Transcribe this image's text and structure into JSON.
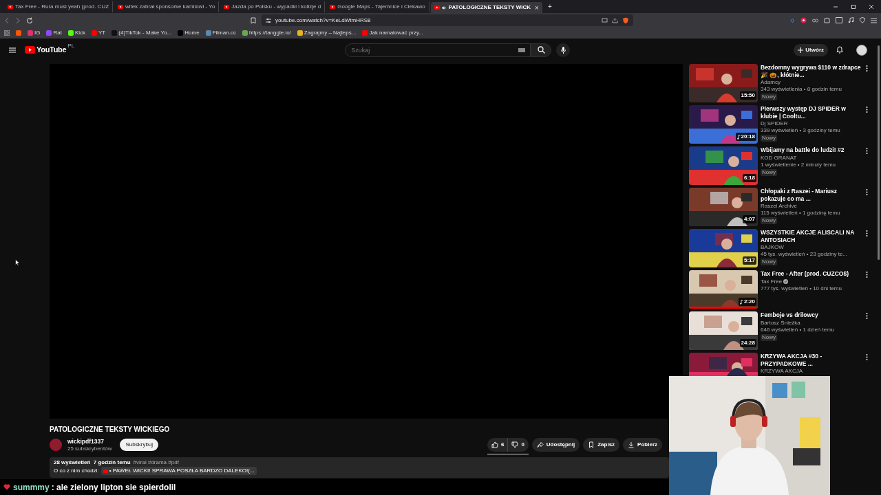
{
  "browser": {
    "tabs": [
      {
        "title": "Tax Free - Rura musi yeah (prod. CUZ",
        "selected": false,
        "audio": false
      },
      {
        "title": "witek zabrał sponsorke kamilowi - Yo",
        "selected": false,
        "audio": false
      },
      {
        "title": "Jazda po Polsku - wypadki i kolizje d",
        "selected": false,
        "audio": false
      },
      {
        "title": "Google Maps - Tajemnice i Ciekawo",
        "selected": false,
        "audio": false
      },
      {
        "title": "PATOLOGICZNE TEKSTY WICK",
        "selected": true,
        "audio": true
      }
    ],
    "close_glyph": "×",
    "new_tab_glyph": "+",
    "url": "youtube.com/watch?v=KeLdWtmHRS8",
    "bookmarks": [
      {
        "color": "#ff5500"
      },
      {
        "label": "IG",
        "color": "#e1306c"
      },
      {
        "label": "Rat",
        "color": "#9146ff"
      },
      {
        "label": "Kick",
        "color": "#53fc18"
      },
      {
        "label": "YT",
        "color": "#ff0000"
      },
      {
        "label": "(4)TikTok - Make Yo...",
        "color": "#111111"
      },
      {
        "label": "Home",
        "color": "#000000"
      },
      {
        "label": "Filman.cc",
        "color": "#5a8ab0"
      },
      {
        "label": "https://tanggle.io/",
        "color": "#6aa84f"
      },
      {
        "label": "Zagrajmy – Najleps...",
        "color": "#e6b422"
      },
      {
        "label": "Jak namalować przy...",
        "color": "#ff0000"
      }
    ]
  },
  "header": {
    "logo": "YouTube",
    "region": "PL",
    "search": {
      "placeholder": "Szukaj"
    },
    "create": "Utwórz"
  },
  "video": {
    "title": "PATOLOGICZNE TEKSTY WICKIEGO",
    "channel": "wickipdf1337",
    "subscribers": "25 subskrybentów",
    "subscribe": "Subskrybuj",
    "likes": "6",
    "dislikes": "0",
    "actions": [
      "Udostępnij",
      "Zapisz",
      "Pobierz"
    ],
    "description": {
      "stats": "28 wyświetleń  7 godzin temu",
      "tags": "#viral #drama #pdf",
      "lead": "O co z nim chodzi:",
      "link": "• PAWEŁ WICKI! SPRAWA POSZŁA BARDZO DALEKO!(..."
    }
  },
  "recommendations": [
    {
      "title": "Bezdomny wygrywa $110 w zdrapce 🎉 🎃, kłótnie...",
      "channel": "Adamcy",
      "meta": "343 wyświetlenia • 8 godzin temu",
      "badge": "Nowy",
      "duration": "15:50"
    },
    {
      "title": "Pierwszy występ DJ SPIDER w klubie | Cooltu...",
      "channel": "Dj SPIDER",
      "meta": "339 wyświetleń • 3 godziny temu",
      "badge": "Nowy",
      "duration": "20:18",
      "music": true
    },
    {
      "title": "Wbijamy na battle do ludzi! #2",
      "channel": "KOD GRANAT",
      "meta": "1 wyświetlenie • 2 minuty temu",
      "badge": "Nowy",
      "duration": "6:18"
    },
    {
      "title": "Chłopaki z Raszei - Mariusz pokazuje co ma ...",
      "channel": "Raszei Archive",
      "meta": "115 wyświetleń • 1 godzinę temu",
      "badge": "Nowy",
      "duration": "4:07"
    },
    {
      "title": "WSZYSTKIE AKCJE ALISCALI NA ANTOSIACH",
      "channel": "BAJKOW",
      "meta": "45 tys. wyświetleń • 23 godziny te...",
      "badge": "Nowy",
      "duration": "5:17"
    },
    {
      "title": "Tax Free - After (prod. CUZCO$)",
      "channel": "Tax Free",
      "meta": "777 tys. wyświetleń • 10 dni temu",
      "duration": "2:20",
      "music": true,
      "verified": true,
      "level": 1
    },
    {
      "title": "Femboje vs drilowcy",
      "channel": "Bartosz Śnieżka",
      "meta": "646 wyświetleń • 1 dzień temu",
      "badge": "Nowy",
      "duration": "24:28"
    },
    {
      "title": "KRZYWA AKCJA #30 - PRZYPADKOWE ...",
      "channel": "KRZYWA AKCJA"
    }
  ],
  "chat": {
    "user": "summmy",
    "message": ": ale zielony lipton sie spierdolil"
  }
}
